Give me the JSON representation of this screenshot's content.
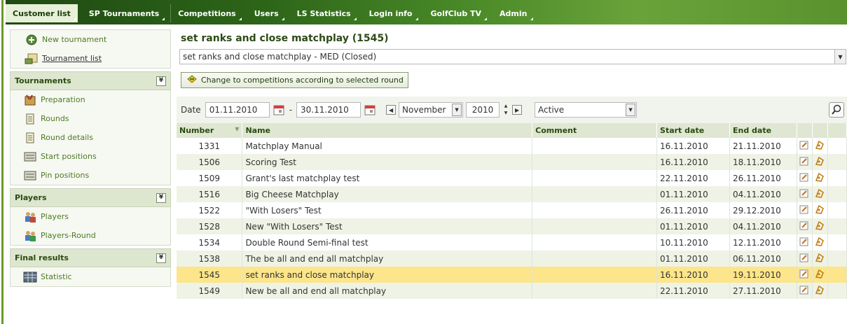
{
  "nav": {
    "tabs": [
      {
        "label": "Customer list",
        "active": true
      },
      {
        "label": "SP Tournaments"
      },
      {
        "label": "Competitions"
      },
      {
        "label": "Users"
      },
      {
        "label": "LS Statistics"
      },
      {
        "label": "Login info"
      },
      {
        "label": "GolfClub TV"
      },
      {
        "label": "Admin"
      }
    ]
  },
  "sidebar": {
    "top_items": [
      {
        "label": "New tournament",
        "icon": "add-tournament-icon"
      },
      {
        "label": "Tournament list",
        "icon": "tournament-list-icon"
      }
    ],
    "groups": [
      {
        "title": "Tournaments",
        "items": [
          {
            "label": "Preparation",
            "icon": "preparation-icon"
          },
          {
            "label": "Rounds",
            "icon": "rounds-icon"
          },
          {
            "label": "Round details",
            "icon": "round-details-icon"
          },
          {
            "label": "Start positions",
            "icon": "start-positions-icon"
          },
          {
            "label": "Pin positions",
            "icon": "pin-positions-icon"
          }
        ]
      },
      {
        "title": "Players",
        "items": [
          {
            "label": "Players",
            "icon": "players-icon"
          },
          {
            "label": "Players-Round",
            "icon": "players-round-icon"
          }
        ]
      },
      {
        "title": "Final results",
        "items": [
          {
            "label": "Statistic",
            "icon": "statistic-icon"
          }
        ]
      }
    ],
    "collapse_glyph": "¥"
  },
  "main": {
    "title": "set ranks and close matchplay (1545)",
    "tournament_select": "set ranks and close matchplay - MED (Closed)",
    "change_button": "Change to competitions according to selected round",
    "filter": {
      "date_label": "Date",
      "date_from": "01.11.2010",
      "date_sep": "-",
      "date_to": "30.11.2010",
      "month": "November",
      "year": "2010",
      "status": "Active"
    },
    "table": {
      "headers": [
        "Number",
        "Name",
        "Comment",
        "Start date",
        "End date"
      ],
      "rows": [
        {
          "number": "1331",
          "name": "Matchplay Manual",
          "comment": "",
          "start": "16.11.2010",
          "end": "21.11.2010"
        },
        {
          "number": "1506",
          "name": "Scoring Test",
          "comment": "",
          "start": "16.11.2010",
          "end": "18.11.2010"
        },
        {
          "number": "1509",
          "name": "Grant's last matchplay test",
          "comment": "",
          "start": "22.11.2010",
          "end": "26.11.2010"
        },
        {
          "number": "1516",
          "name": "Big Cheese Matchplay",
          "comment": "",
          "start": "01.11.2010",
          "end": "04.11.2010"
        },
        {
          "number": "1522",
          "name": "\"With Losers\" Test",
          "comment": "",
          "start": "26.11.2010",
          "end": "29.12.2010"
        },
        {
          "number": "1528",
          "name": "New \"With Losers\" Test",
          "comment": "",
          "start": "01.11.2010",
          "end": "04.11.2010"
        },
        {
          "number": "1534",
          "name": "Double Round Semi-final test",
          "comment": "",
          "start": "10.11.2010",
          "end": "12.11.2010"
        },
        {
          "number": "1538",
          "name": "The be all and end all matchplay",
          "comment": "",
          "start": "01.11.2010",
          "end": "06.11.2010"
        },
        {
          "number": "1545",
          "name": "set ranks and close matchplay",
          "comment": "",
          "start": "16.11.2010",
          "end": "19.11.2010",
          "selected": true
        },
        {
          "number": "1549",
          "name": "New be all and end all matchplay",
          "comment": "",
          "start": "22.11.2010",
          "end": "27.11.2010"
        }
      ]
    }
  },
  "colors": {
    "nav_dark": "#1f4a12",
    "nav_light": "#6aa23a",
    "selected_row": "#fce58a",
    "even_row": "#eff3e6",
    "header_bg": "#dfe7d2"
  }
}
